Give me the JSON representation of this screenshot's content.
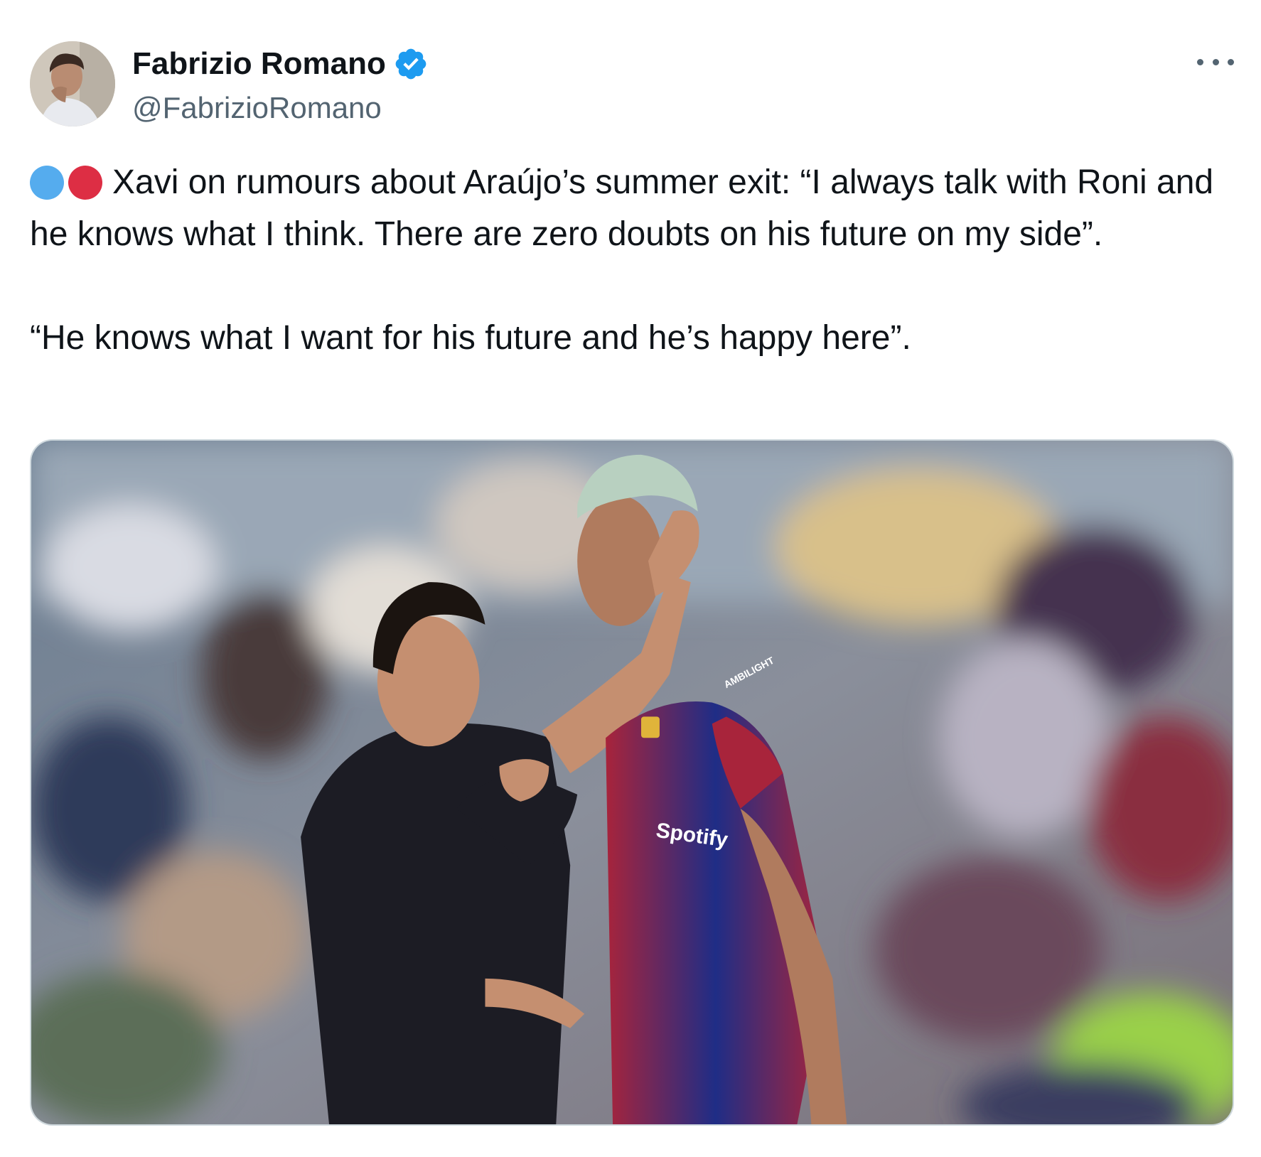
{
  "author": {
    "name": "Fabrizio Romano",
    "handle": "@FabrizioRomano",
    "verified": true,
    "avatar_icon": "profile-photo"
  },
  "menu_icon": "more-horizontal-icon",
  "tweet": {
    "emoji": [
      "blue-circle",
      "red-circle"
    ],
    "paragraph_1": "Xavi on rumours about Araújo’s summer exit: “I always talk with Roni and he knows what I think. There are zero doubts on his future on my side”.",
    "paragraph_2": "“He knows what I want for his future and he’s happy here”."
  },
  "media": {
    "jersey_sleeve_text": "AMBILIGHT",
    "jersey_sponsor_text": "Spotify"
  },
  "colors": {
    "text_primary": "#0f1419",
    "text_secondary": "#536471",
    "verified_blue": "#1d9bf0",
    "emoji_blue": "#55acee",
    "emoji_red": "#dd2e44",
    "border": "#cfd9de"
  }
}
